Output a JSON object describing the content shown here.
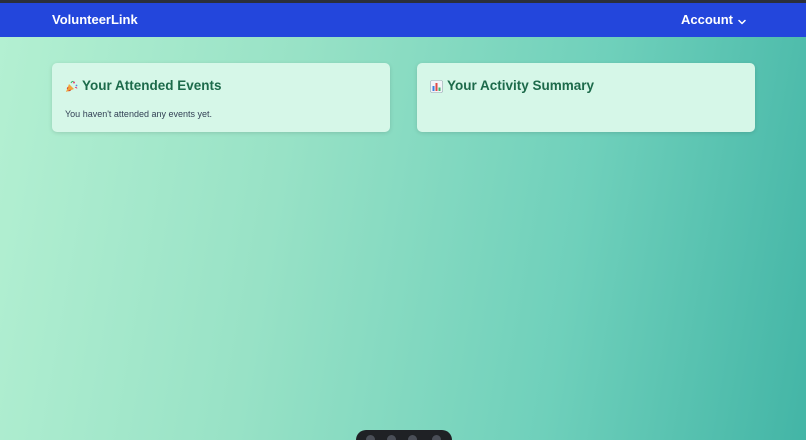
{
  "navbar": {
    "brand": "VolunteerLink",
    "account_label": "Account",
    "background": "#2346dc"
  },
  "cards": {
    "attended_events": {
      "icon": "party-popper-icon",
      "title": "Your Attended Events",
      "empty_text": "You haven't attended any events yet."
    },
    "activity_summary": {
      "icon": "bar-chart-icon",
      "title": "Your Activity Summary"
    }
  },
  "colors": {
    "card_background": "#d6f7e8",
    "title_color": "#1c6a4a",
    "gradient_start": "#b4f0d2",
    "gradient_end": "#43b5a6"
  }
}
